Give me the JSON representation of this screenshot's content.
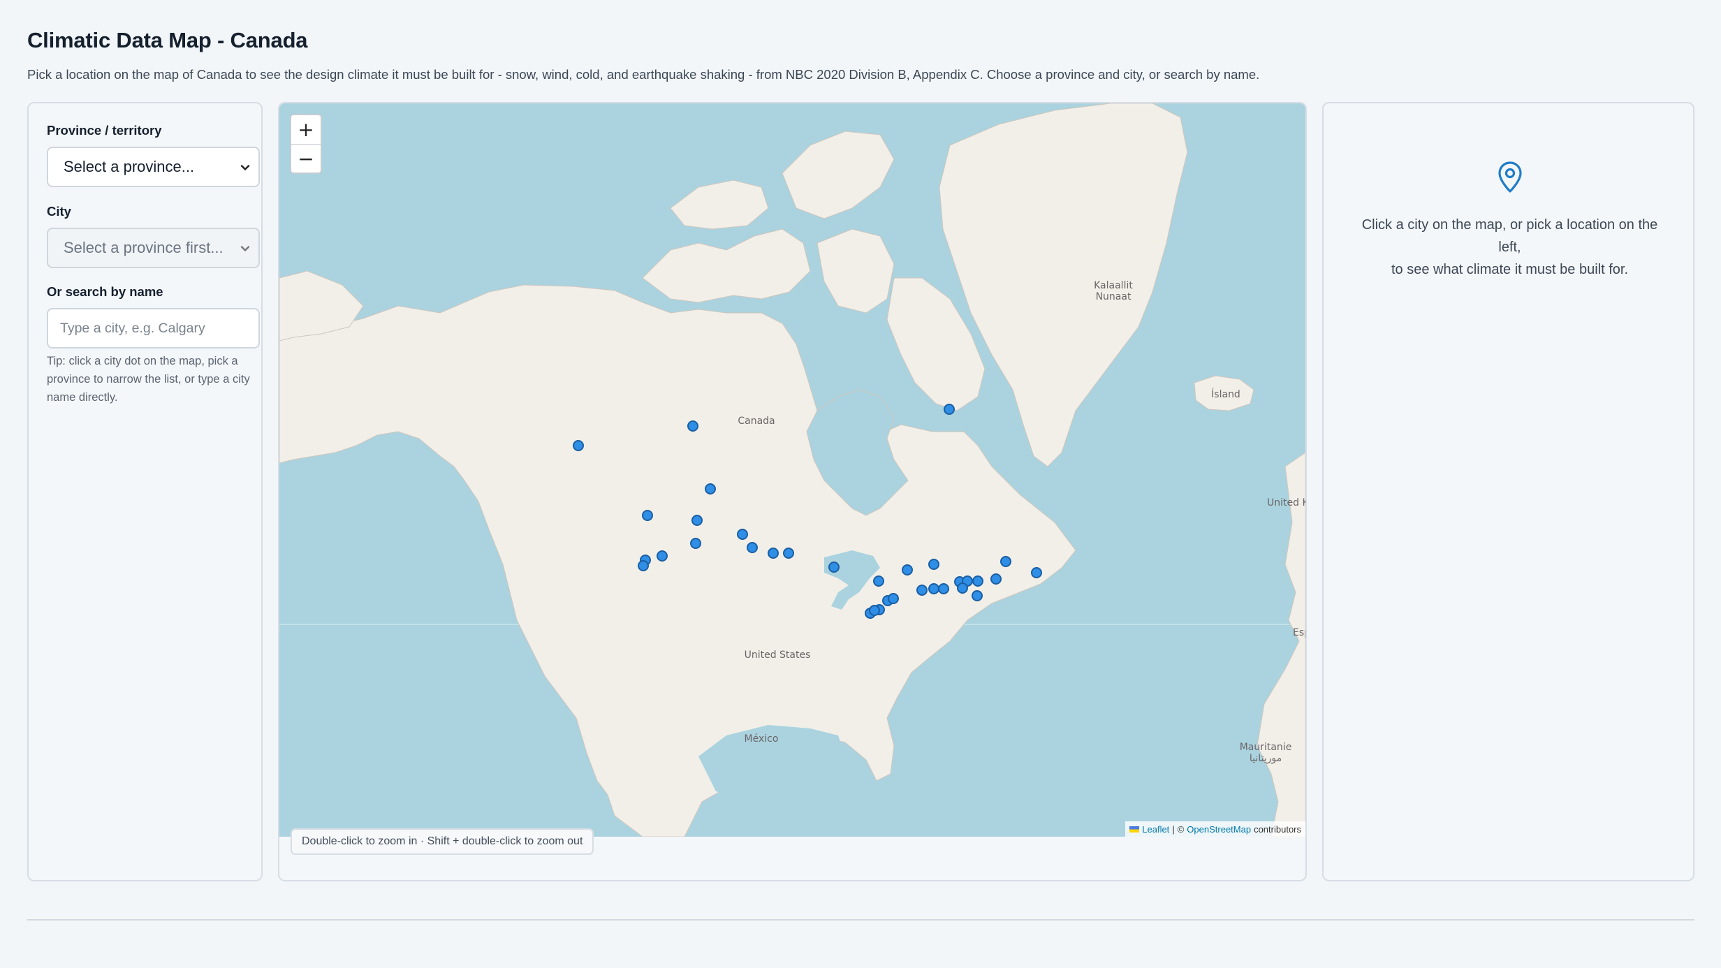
{
  "header": {
    "title": "Climatic Data Map - Canada",
    "description": "Pick a location on the map of Canada to see the design climate it must be built for - snow, wind, cold, and earthquake shaking - from NBC 2020 Division B, Appendix C. Choose a province and city, or search by name."
  },
  "sidebar": {
    "province_label": "Province / territory",
    "province_value": "Select a province...",
    "city_label": "City",
    "city_value": "Select a province first...",
    "search_label": "Or search by name",
    "search_placeholder": "Type a city, e.g. Calgary",
    "tip": "Tip: click a city dot on the map, pick a province to narrow the list, or type a city name directly."
  },
  "map": {
    "zoom_in": "+",
    "zoom_out": "−",
    "labels": {
      "canada": "Canada",
      "united_states": "United States",
      "mexico": "México",
      "greenland_1": "Kalaallit",
      "greenland_2": "Nunaat",
      "iceland": "Ísland",
      "uk": "United K",
      "spain": "Esp",
      "mauritania_1": "Mauritanie",
      "mauritania_2": "موريتانيا"
    },
    "attribution": {
      "leaflet": "Leaflet",
      "separator": "|",
      "copyright": "©",
      "osm": "OpenStreetMap",
      "contributors": "contributors"
    },
    "hint": "Double-click to zoom in · Shift + double-click to zoom out",
    "marker_color": "#2f8ee6"
  },
  "details": {
    "icon": "map-pin-icon",
    "line1": "Click a city on the map, or pick a location on the left,",
    "line2": "to see what climate it must be built for."
  }
}
